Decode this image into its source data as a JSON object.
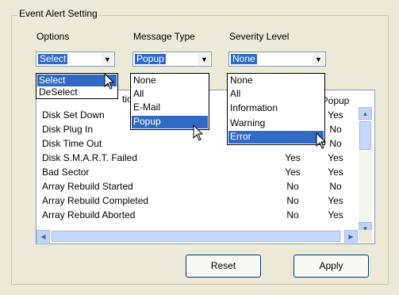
{
  "group_title": "Event Alert Setting",
  "columns": {
    "options": "Options",
    "message_type": "Message Type",
    "severity_level": "Severity Level"
  },
  "combos": {
    "options_value": "Select",
    "message_type_value": "Popup",
    "severity_value": "None"
  },
  "dropdowns": {
    "options": [
      "Select",
      "DeSelect"
    ],
    "message_type": [
      "None",
      "All",
      "E-Mail",
      "Popup"
    ],
    "severity": [
      "None",
      "All",
      "Information",
      "Warning",
      "Error"
    ]
  },
  "table": {
    "partial_header_fragment": "tio",
    "popup_header": "Popup",
    "rows": [
      {
        "event": "Disk Set Down",
        "col1": "",
        "popup": "Yes"
      },
      {
        "event": "Disk Plug In",
        "col1": "",
        "popup": "No"
      },
      {
        "event": "Disk Time Out",
        "col1": "",
        "popup": "No"
      },
      {
        "event": "Disk S.M.A.R.T. Failed",
        "col1": "Yes",
        "popup": "Yes"
      },
      {
        "event": "Bad Sector",
        "col1": "Yes",
        "popup": "Yes"
      },
      {
        "event": "Array Rebuild Started",
        "col1": "No",
        "popup": "No"
      },
      {
        "event": "Array Rebuild Completed",
        "col1": "No",
        "popup": "Yes"
      },
      {
        "event": "Array Rebuild Aborted",
        "col1": "No",
        "popup": "Yes"
      }
    ]
  },
  "buttons": {
    "reset": "Reset",
    "apply": "Apply"
  },
  "colors": {
    "selection": "#316ac5",
    "window_bg": "#ece9d8"
  }
}
